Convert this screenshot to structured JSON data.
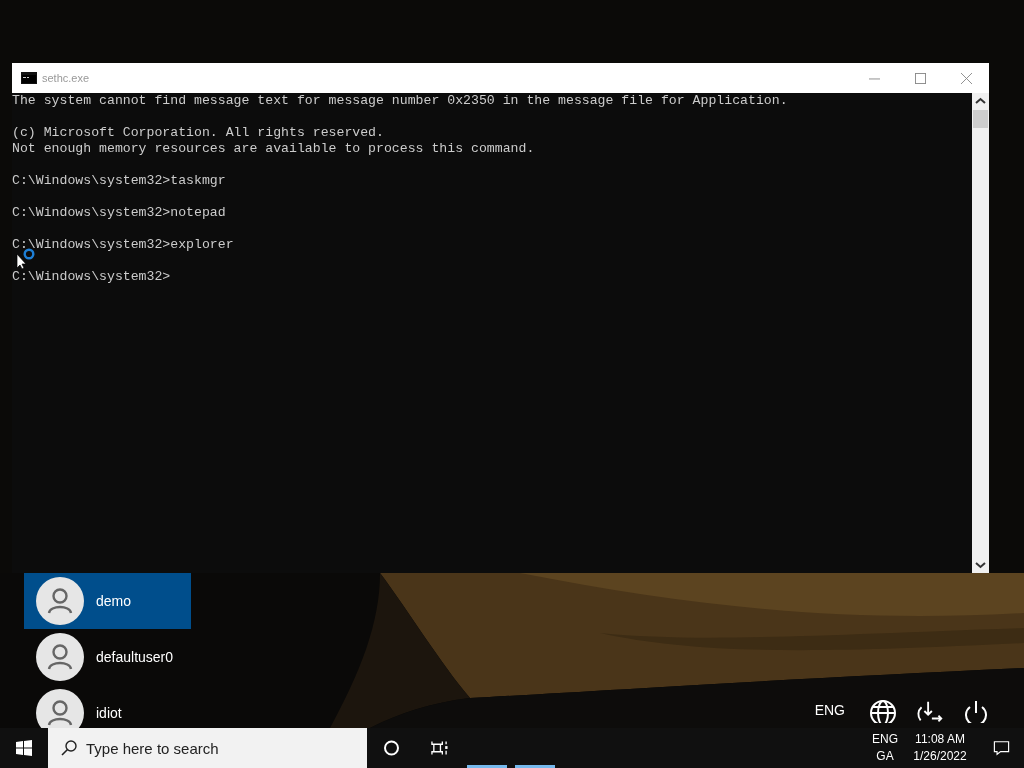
{
  "window": {
    "title": "sethc.exe"
  },
  "console": {
    "blocks": [
      [
        "The system cannot find message text for message number 0x2350 in the message file for Application."
      ],
      [
        "(c) Microsoft Corporation. All rights reserved.",
        "Not enough memory resources are available to process this command."
      ],
      [
        "C:\\Windows\\system32>taskmgr"
      ],
      [
        "C:\\Windows\\system32>notepad"
      ],
      [
        "C:\\Windows\\system32>explorer"
      ],
      [
        "C:\\Windows\\system32>"
      ]
    ]
  },
  "users": [
    {
      "name": "demo",
      "selected": true
    },
    {
      "name": "defaultuser0",
      "selected": false
    },
    {
      "name": "idiot",
      "selected": false
    }
  ],
  "login_language": "ENG",
  "taskbar": {
    "search": {
      "placeholder": "Type here to search"
    },
    "tray": {
      "language": "ENG",
      "layout": "GA",
      "time": "11:08 AM",
      "date": "1/26/2022"
    }
  }
}
